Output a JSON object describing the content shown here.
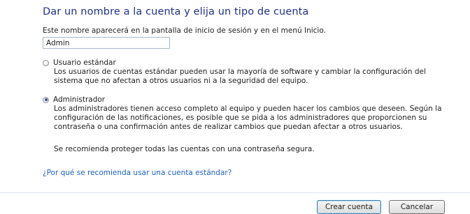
{
  "heading": "Dar un nombre a la cuenta y elija un tipo de cuenta",
  "name_prompt": "Este nombre aparecerá en la pantalla de inicio de sesión y en el menú Inicio.",
  "account_name": "Admin",
  "options": {
    "standard": {
      "label": "Usuario estándar",
      "description_1": "Los usuarios de cuentas estándar pueden usar la mayoría de software y cambiar la configuración del",
      "description_2": "sistema que no afectan a otros usuarios ni a la seguridad del equipo.",
      "selected": false
    },
    "admin": {
      "label": "Administrador",
      "description_1": "Los administradores tienen acceso completo al equipo y pueden hacer los cambios que deseen. Según la",
      "description_2": "configuración de las notificaciones, es posible que se pida a los administradores que proporcionen su",
      "description_3": "contraseña o una confirmación antes de realizar cambios que puedan afectar a otros usuarios.",
      "selected": true
    }
  },
  "recommendation": "Se recomienda proteger todas las cuentas con una contraseña segura.",
  "help_link": "¿Por qué se recomienda usar una cuenta estándar?",
  "buttons": {
    "create": "Crear cuenta",
    "cancel": "Cancelar"
  }
}
